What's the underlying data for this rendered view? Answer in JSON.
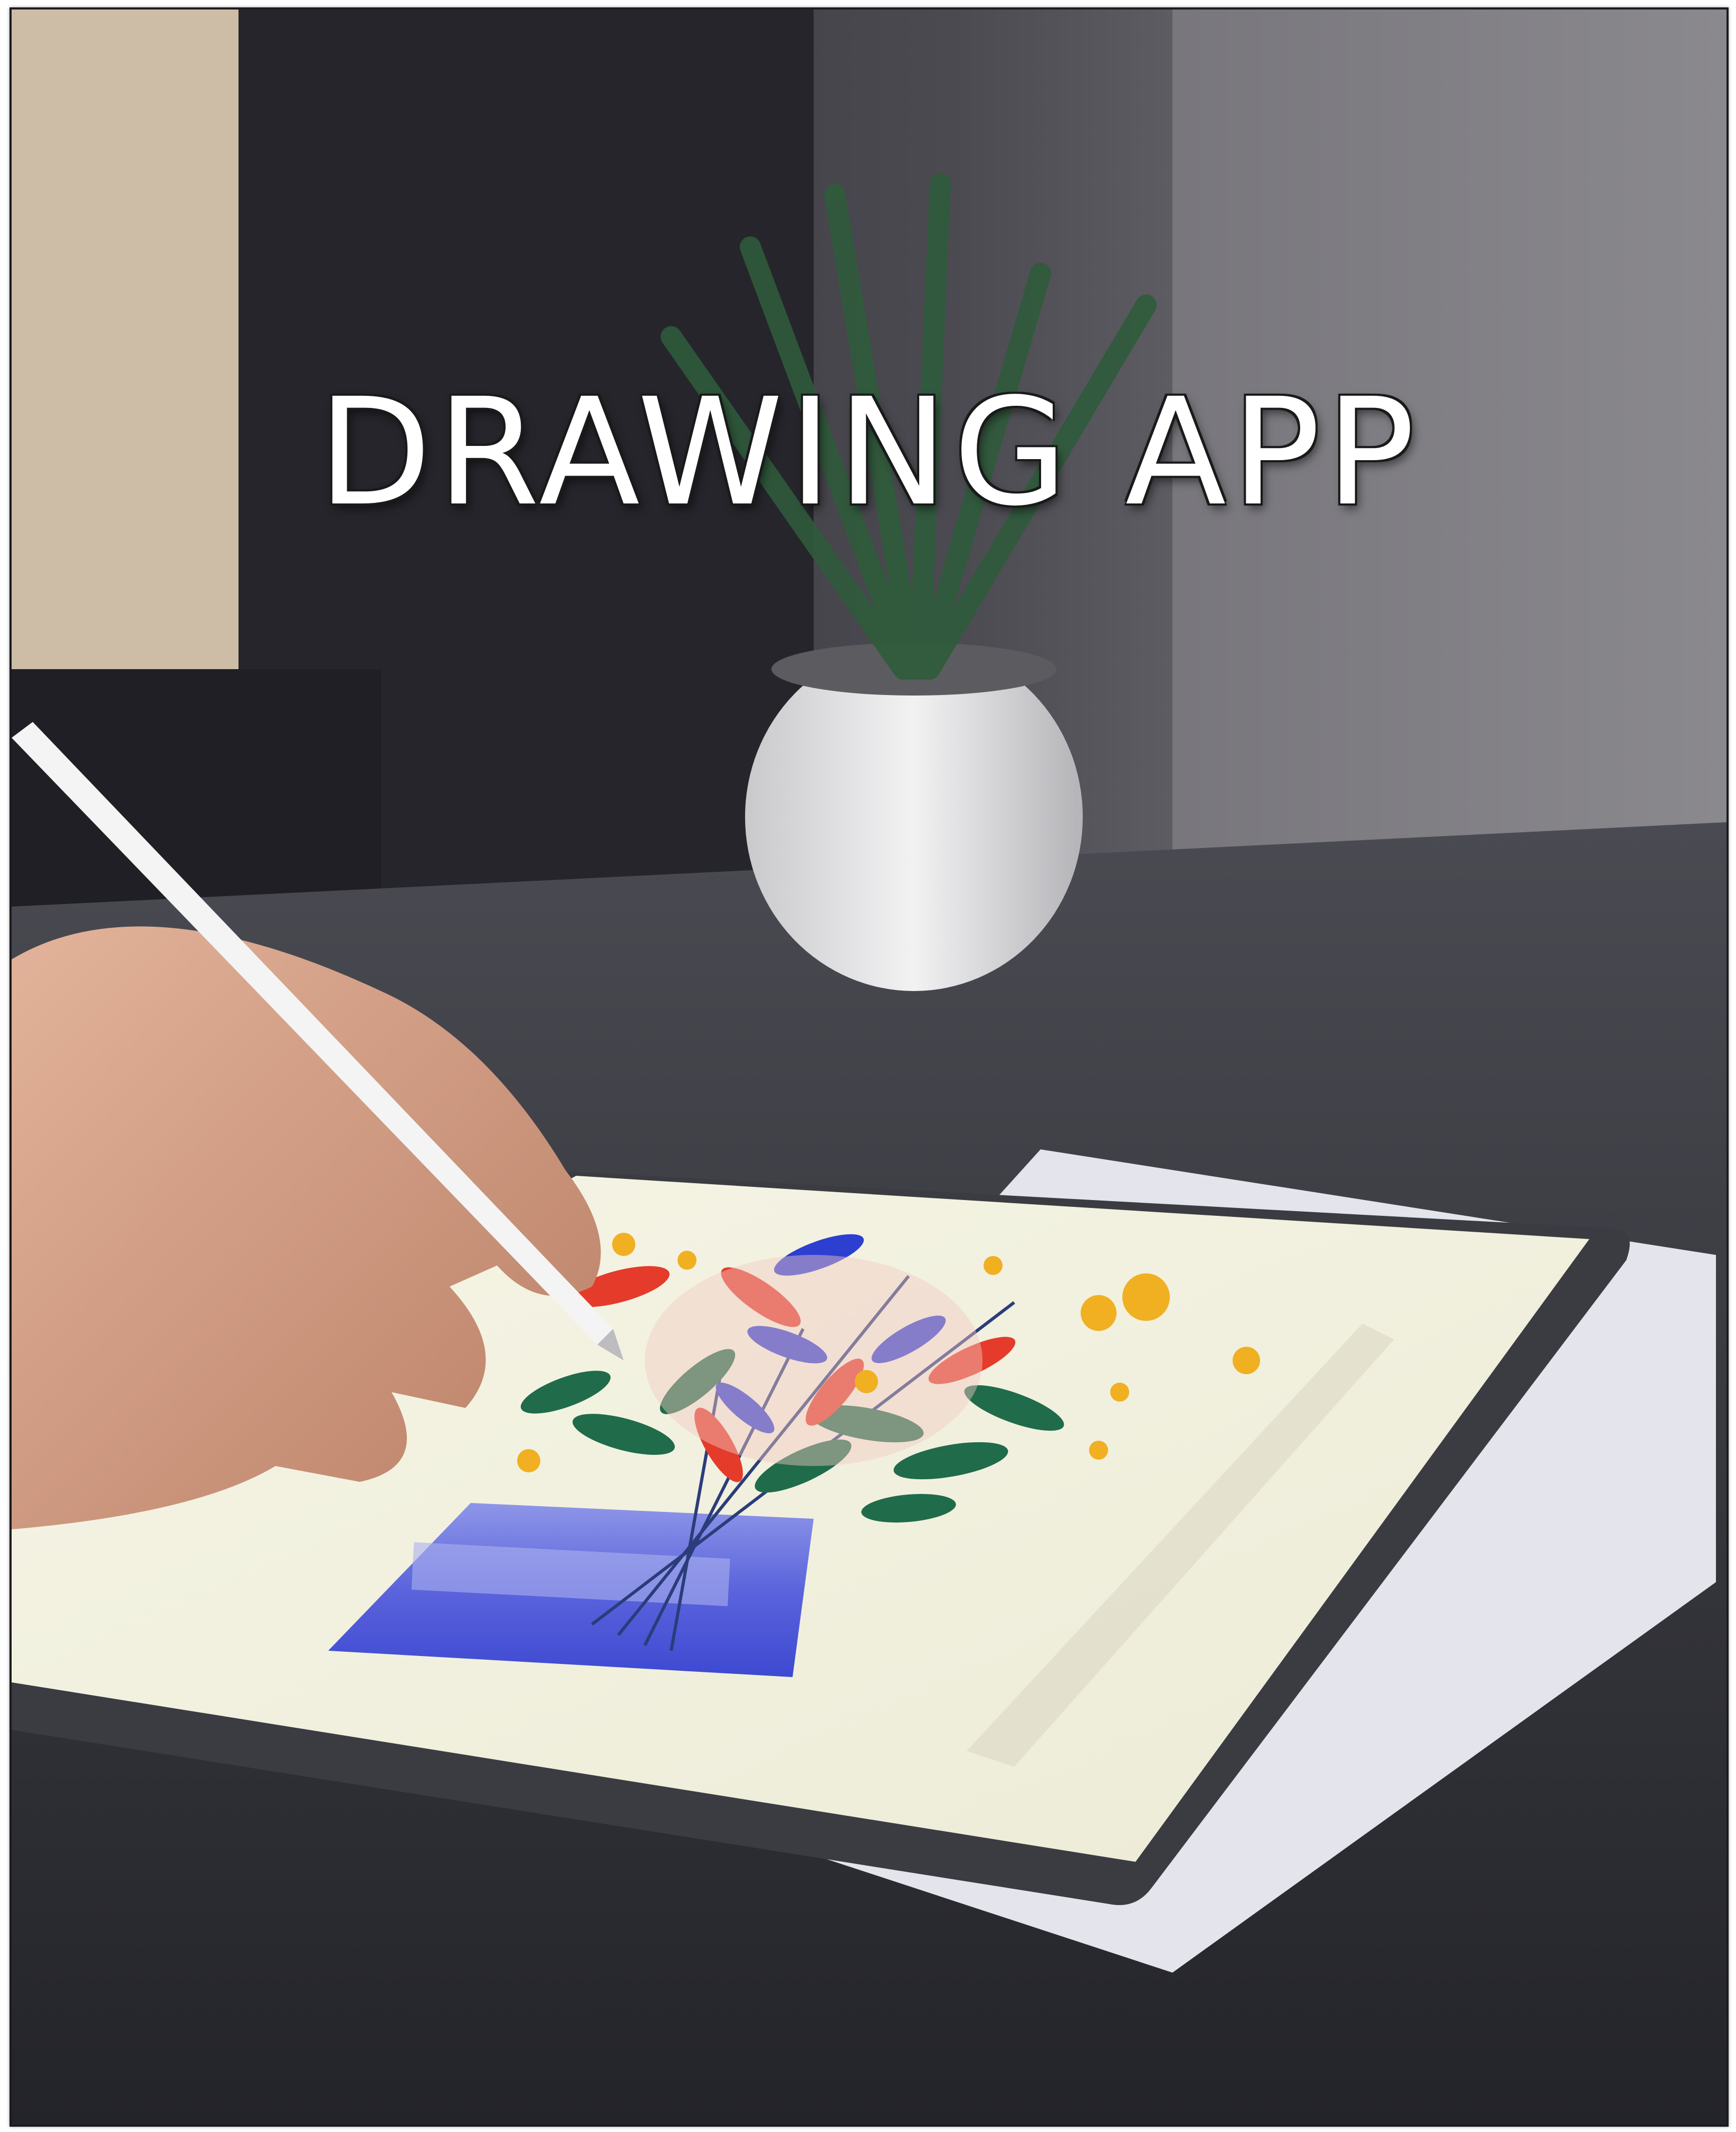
{
  "poster": {
    "title": "DRAWING APP"
  },
  "colors": {
    "wall": "#6e6d72",
    "curtain": "#2b2a31",
    "table": "#2f3036",
    "paper": "#e8e8ee",
    "tablet_frame": "#3b3b42",
    "screen": "#f1f0dc",
    "vase": "#4a55d6",
    "leaf": "#1f6b4a",
    "petal_red": "#e43b2a",
    "petal_blue": "#2c3fd0",
    "dot_yellow": "#f0b021"
  }
}
